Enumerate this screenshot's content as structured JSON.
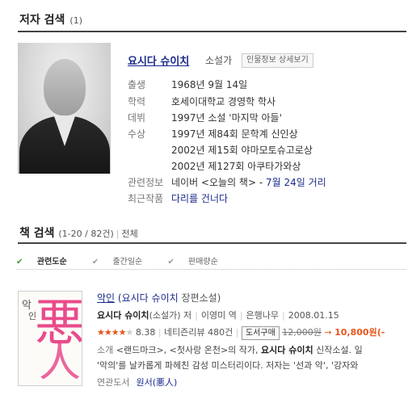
{
  "author_section": {
    "title": "저자 검색",
    "count": "(1)",
    "author": {
      "name": "요시다 슈이치",
      "job": "소설가",
      "detail_button": "인물정보 상세보기",
      "info": [
        {
          "label": "출생",
          "value": "1968년 9월 14일"
        },
        {
          "label": "학력",
          "value": "호세이대학교 경영학 학사"
        },
        {
          "label": "데뷔",
          "value": "1997년 소설 '마지막 아들'"
        },
        {
          "label": "수상",
          "value": "1997년 제84회 문학계 신인상"
        },
        {
          "label": "",
          "value": "2002년 제15회 야마모토슈고로상"
        },
        {
          "label": "",
          "value": "2002년 제127회 아쿠타가와상"
        }
      ],
      "related": {
        "label": "관련정보",
        "prefix": "네이버 <오늘의 책> - ",
        "link": "7월 24일 거리"
      },
      "recent": {
        "label": "최근작품",
        "link": "다리를 건너다"
      }
    }
  },
  "book_section": {
    "title": "책 검색",
    "range": "(1-20 / 82건)",
    "separator": "|",
    "all_label": "전체",
    "sort_options": [
      {
        "label": "관련도순",
        "active": true
      },
      {
        "label": "출간일순",
        "active": false
      },
      {
        "label": "판매량순",
        "active": false
      }
    ],
    "books": [
      {
        "cover": {
          "small1": "악",
          "small2": "인",
          "big1": "悪",
          "big2": "人",
          "accent": "#e94b8c"
        },
        "title": "악인",
        "author_line": "(요시다 슈이치",
        "genre": "장편소설)",
        "author": "요시다 슈이치",
        "author_role": "(소설가) 저",
        "translator": "이영미 역",
        "publisher": "은행나무",
        "date": "2008.01.15",
        "rating_stars": 4,
        "rating": "8.38",
        "reviews": "네티즌리뷰 480건",
        "buy_button": "도서구매",
        "original_price": "12,000원",
        "arrow": "→",
        "sale_price": "10,800원(-",
        "desc_label": "소개",
        "desc_part1": "<랜드마크>, <첫사랑 온천>의 작가,",
        "desc_bold": "요시다 슈이치",
        "desc_part2": "신작소설. 일",
        "desc_line2": "'악의'를 날카롭게 파헤친 감성 미스터리이다. 저자는 '선과 악', '강자와",
        "related_label": "연관도서",
        "related_link": "원서(悪人)"
      }
    ]
  }
}
